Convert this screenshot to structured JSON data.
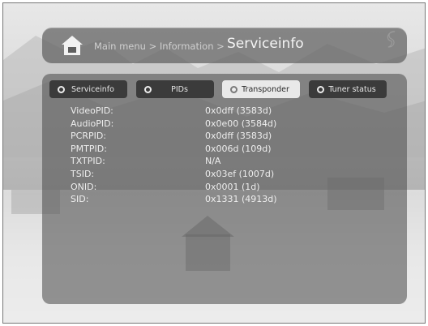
{
  "header": {
    "breadcrumb": "Main menu > Information > ",
    "title": "Serviceinfo"
  },
  "tabs": [
    {
      "label": "Serviceinfo",
      "state": "inactive"
    },
    {
      "label": "PIDs",
      "state": "inactive"
    },
    {
      "label": "Transponder",
      "state": "active"
    },
    {
      "label": "Tuner status",
      "state": "inactive"
    }
  ],
  "rows": [
    {
      "key": "VideoPID:",
      "value": "0x0dff (3583d)"
    },
    {
      "key": "AudioPID:",
      "value": "0x0e00 (3584d)"
    },
    {
      "key": "PCRPID:",
      "value": "0x0dff (3583d)"
    },
    {
      "key": "PMTPID:",
      "value": "0x006d (109d)"
    },
    {
      "key": "TXTPID:",
      "value": "N/A"
    },
    {
      "key": "TSID:",
      "value": "0x03ef (1007d)"
    },
    {
      "key": "ONID:",
      "value": "0x0001 (1d)"
    },
    {
      "key": "SID:",
      "value": "0x1331 (4913d)"
    }
  ],
  "icons": {
    "home": "home-icon",
    "logo": "brand-logo-icon"
  },
  "colors": {
    "panel": "#505050",
    "active_tab": "#e9e9e9",
    "inactive_tab": "#3b3b3b"
  }
}
